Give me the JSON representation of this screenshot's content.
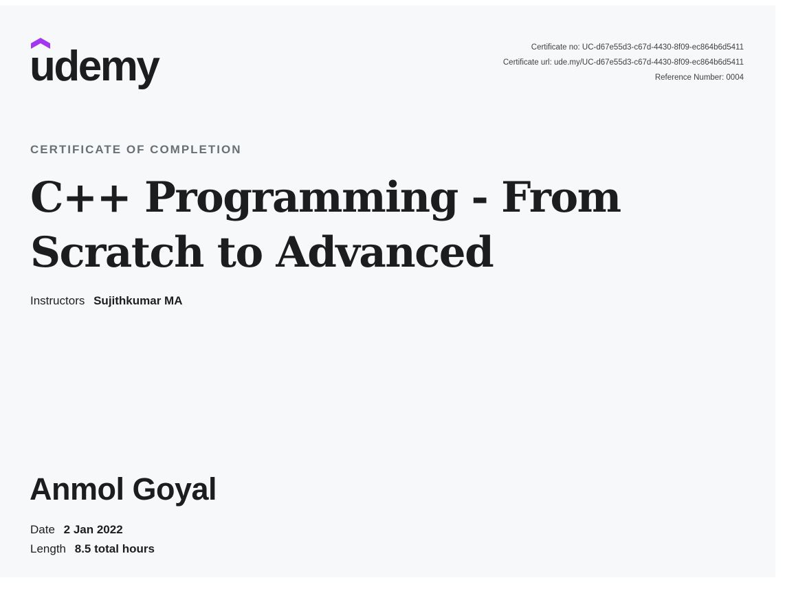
{
  "brand": {
    "logo_text": "udemy",
    "accent_color": "#a435f0"
  },
  "certificate": {
    "number_line": "Certificate no: UC-d67e55d3-c67d-4430-8f09-ec864b6d5411",
    "url_line": "Certificate url: ude.my/UC-d67e55d3-c67d-4430-8f09-ec864b6d5411",
    "reference_line": "Reference Number: 0004",
    "kicker": "CERTIFICATE OF COMPLETION",
    "course_title": "C++ Programming - From Scratch to Advanced",
    "instructors_label": "Instructors",
    "instructor_name": "Sujithkumar MA",
    "student_name": "Anmol Goyal",
    "date_label": "Date",
    "date_value": "2 Jan 2022",
    "length_label": "Length",
    "length_value": "8.5 total hours"
  }
}
